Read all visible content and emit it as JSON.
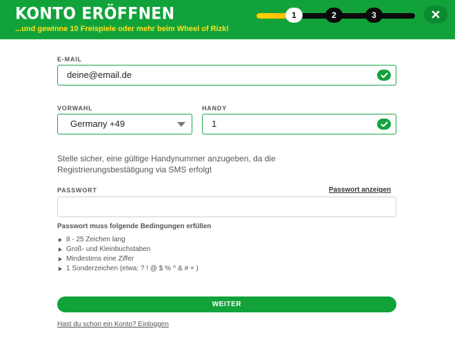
{
  "header": {
    "title": "KONTO ERÖFFNEN",
    "subtitle": "...und gewinne 10 Freispiele oder mehr beim Wheel of Rizk!",
    "close_icon": "close-icon",
    "brand_color": "#11a33a",
    "accent_color": "#ffe21a"
  },
  "progress": {
    "current_step": 1,
    "fill_fraction": 0.26,
    "steps": [
      "1",
      "2",
      "3"
    ]
  },
  "form": {
    "email": {
      "label": "E-MAIL",
      "value": "deine@email.de",
      "status_icon": "check-icon"
    },
    "country_code": {
      "label": "VORWAHL",
      "selected": "Germany +49",
      "icon": "chevron-down-icon"
    },
    "phone": {
      "label": "HANDY",
      "value": "1",
      "status_icon": "check-icon"
    },
    "info_text": "Stelle sicher, eine gültige Handynummer anzugeben, da die Registrierungsbestätigung via SMS erfolgt",
    "password": {
      "label": "PASSWORT",
      "value": "",
      "show_link": "Passwort anzeigen"
    },
    "rules": {
      "title": "Passwort muss folgende Bedingungen erfüllen",
      "items": [
        "8 - 25 Zeichen lang",
        "Groß- und Kleinbuchstaben",
        "Mindestens eine Ziffer",
        "1 Sonderzeichen (etwa: ? ! @ $ % ^ & # + )"
      ]
    },
    "submit_label": "WEITER",
    "login_link": "Hast du schon ein Konto? Einloggen"
  }
}
